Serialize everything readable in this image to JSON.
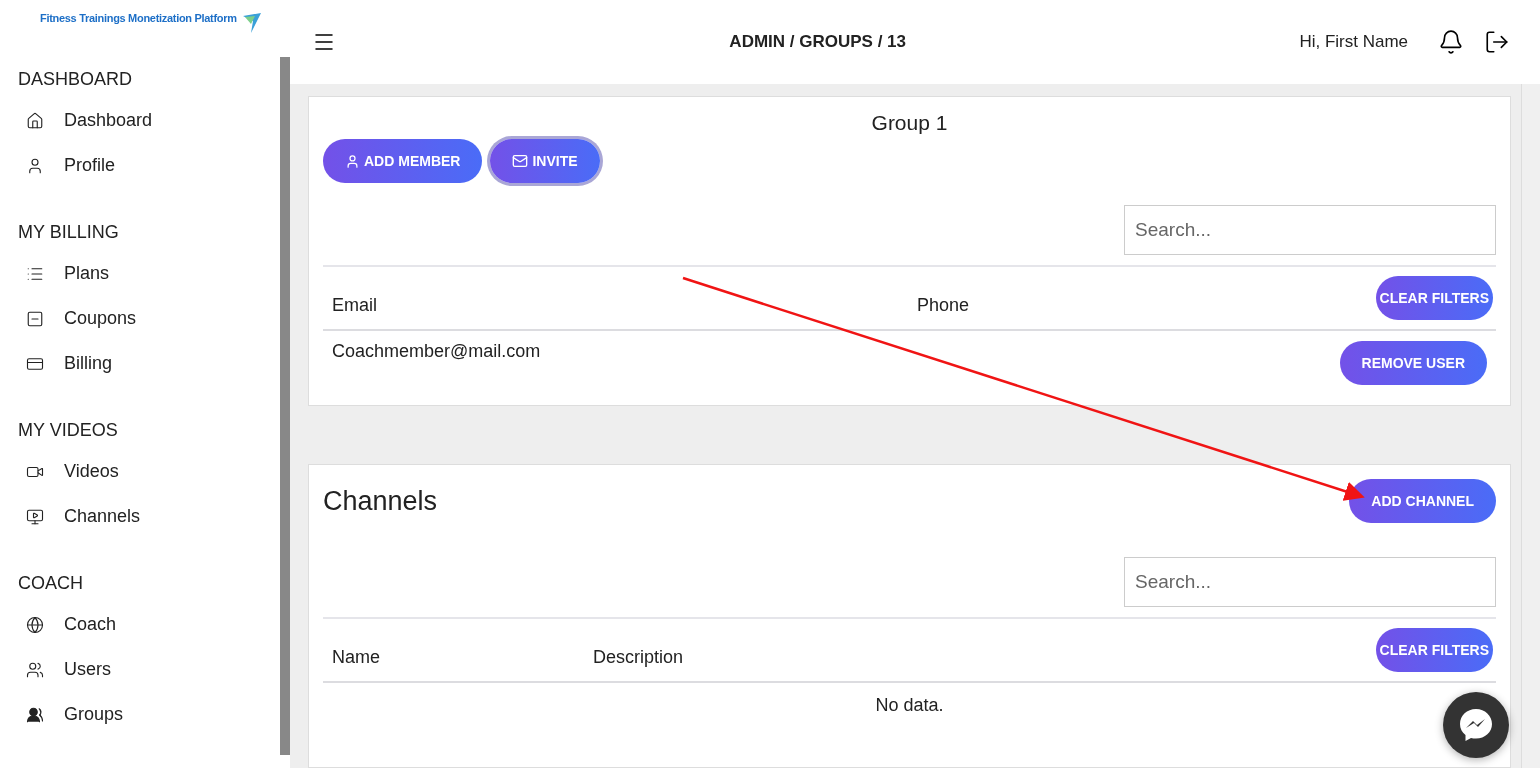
{
  "logo": {
    "text": "Fitness Trainings Monetization Platform"
  },
  "sidebar": {
    "sections": [
      {
        "title": "DASHBOARD",
        "items": [
          {
            "label": "Dashboard",
            "selected": false
          },
          {
            "label": "Profile",
            "selected": false
          }
        ]
      },
      {
        "title": "MY BILLING",
        "items": [
          {
            "label": "Plans",
            "selected": false
          },
          {
            "label": "Coupons",
            "selected": false
          },
          {
            "label": "Billing",
            "selected": false
          }
        ]
      },
      {
        "title": "MY VIDEOS",
        "items": [
          {
            "label": "Videos",
            "selected": false
          },
          {
            "label": "Channels",
            "selected": false
          }
        ]
      },
      {
        "title": "COACH",
        "items": [
          {
            "label": "Coach",
            "selected": false
          },
          {
            "label": "Users",
            "selected": false
          },
          {
            "label": "Groups",
            "selected": false
          }
        ]
      }
    ]
  },
  "header": {
    "breadcrumb": "ADMIN / GROUPS / 13",
    "greeting": "Hi, First Name"
  },
  "group_card": {
    "title": "Group 1",
    "buttons": [
      {
        "label": "ADD MEMBER",
        "focused": false
      },
      {
        "label": "INVITE",
        "focused": true
      }
    ],
    "search": {
      "placeholder": "Search..."
    },
    "table": {
      "columns": [
        "Email",
        "Phone"
      ],
      "clear_button": "CLEAR FILTERS",
      "rows": [
        {
          "cells": [
            "Coachmember@mail.com",
            ""
          ],
          "action": "REMOVE USER"
        }
      ]
    }
  },
  "channels_card": {
    "title": "Channels",
    "add_button": "ADD CHANNEL",
    "search": {
      "placeholder": "Search..."
    },
    "table": {
      "columns": [
        "Name",
        "Description"
      ],
      "clear_button": "CLEAR FILTERS",
      "empty": "No data."
    }
  }
}
